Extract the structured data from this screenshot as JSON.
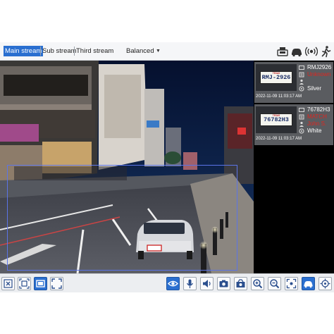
{
  "toolbar": {
    "streams": [
      "Main stream",
      "Sub stream",
      "Third stream"
    ],
    "active_stream": "Main stream",
    "quality": "Balanced"
  },
  "panel": {
    "records": [
      {
        "plate_header": "TEXAS",
        "plate_image_text": "RMJ-2926",
        "plate": "RMJ2926",
        "match": "Unknown",
        "match_color": "#e0261f",
        "owner": "",
        "color": "Silver",
        "timestamp": "2022-11-09 11:03:17 AM"
      },
      {
        "plate_header": "TEXAS",
        "plate_image_text": "76782H3",
        "plate": "76782H3",
        "match": "MATCH",
        "match_color": "#e0261f",
        "owner": "John S.",
        "color": "White",
        "timestamp": "2022-11-09 11:03:17 AM"
      }
    ]
  },
  "bottom_toolbar": {
    "left_buttons": [
      "close-icon",
      "fit-screen-icon",
      "window-icon",
      "fullscreen-icon"
    ],
    "right_buttons": [
      "eye-icon",
      "microphone-icon",
      "speaker-icon",
      "snapshot-icon",
      "record-icon",
      "zoom-in-icon",
      "zoom-out-icon",
      "focus-icon",
      "car-icon",
      "target-icon"
    ]
  },
  "colors": {
    "accent": "#2a6fd0",
    "alert": "#e0261f",
    "detection_box": "#5b74e8"
  }
}
